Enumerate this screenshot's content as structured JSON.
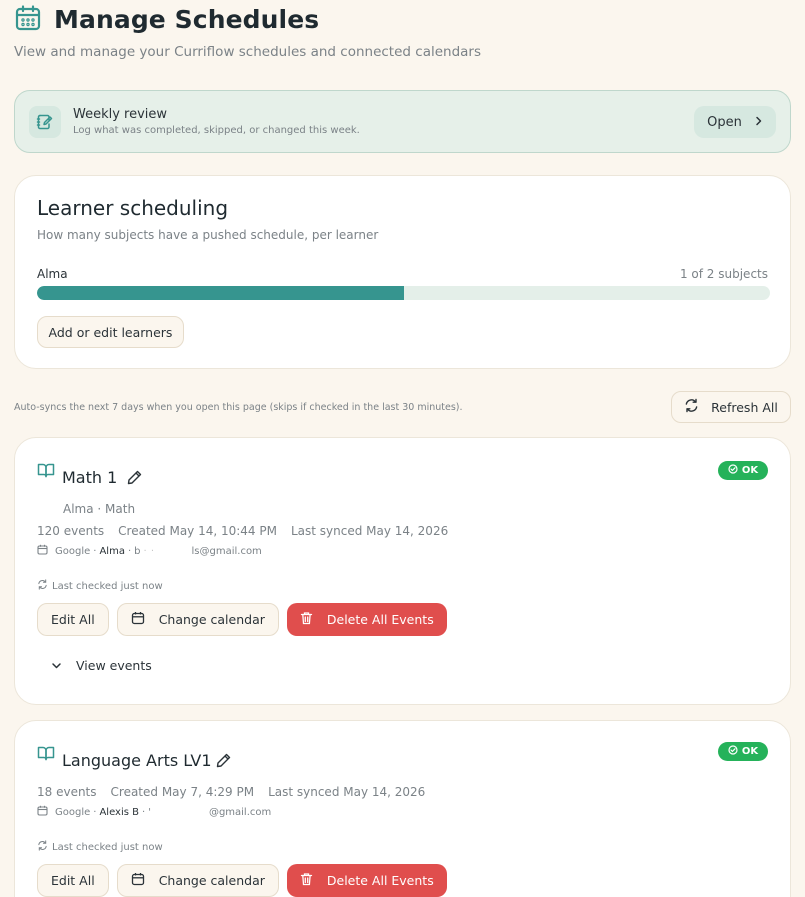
{
  "header": {
    "title": "Manage Schedules",
    "subtitle": "View and manage your Curriflow schedules and connected calendars"
  },
  "weekly_review": {
    "title": "Weekly review",
    "subtitle": "Log what was completed, skipped, or changed this week.",
    "open_label": "Open"
  },
  "learner_scheduling": {
    "title": "Learner scheduling",
    "subtitle": "How many subjects have a pushed schedule, per learner",
    "learner_name": "Alma",
    "count_text": "1 of 2 subjects",
    "progress_fraction": 0.5,
    "add_button": "Add or edit learners"
  },
  "autosync_text": "Auto-syncs the next 7 days when you open this page (skips if checked in the last 30 minutes).",
  "refresh_label": "Refresh All",
  "schedules": [
    {
      "title": "Math 1",
      "status": "OK",
      "meta": "Alma · Math",
      "events": "120 events",
      "created": "Created May 14, 10:44 PM",
      "last_synced": "Last synced May 14, 2026",
      "provider": "Google",
      "account": "Alma",
      "email_prefix": "b",
      "email_domain": "ls@gmail.com",
      "last_checked": "Last checked just now",
      "edit_label": "Edit All",
      "change_label": "Change calendar",
      "delete_label": "Delete All Events",
      "view_events_label": "View events"
    },
    {
      "title": "Language Arts LV1",
      "status": "OK",
      "events": "18 events",
      "created": "Created May 7, 4:29 PM",
      "last_synced": "Last synced May 14, 2026",
      "provider": "Google",
      "account": "Alexis B",
      "email_prefix": "'",
      "email_domain": "@gmail.com",
      "last_checked": "Last checked just now",
      "edit_label": "Edit All",
      "change_label": "Change calendar",
      "delete_label": "Delete All Events"
    }
  ],
  "colors": {
    "background": "#fbf6ee",
    "accent": "#36958f",
    "ok": "#25b25a",
    "danger": "#e04e4d"
  }
}
